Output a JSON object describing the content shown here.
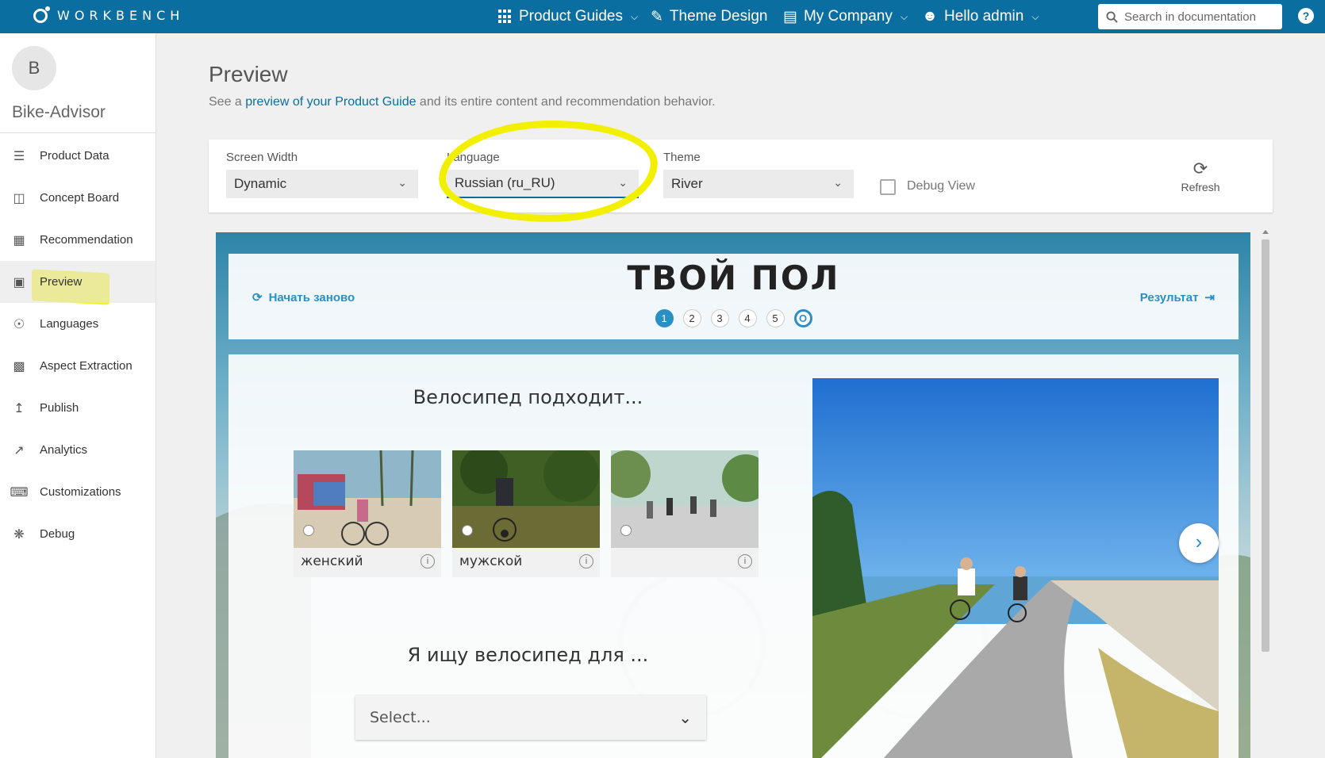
{
  "app": {
    "logo_text": "WORKBENCH"
  },
  "topnav": {
    "product_guides": "Product Guides",
    "theme_design": "Theme Design",
    "my_company": "My Company",
    "hello": "Hello admin",
    "search_placeholder": "Search in documentation",
    "help": "?"
  },
  "sidebar": {
    "avatar_letter": "B",
    "account_name": "Bike-Advisor",
    "items": [
      {
        "label": "Product Data",
        "icon": "database-icon"
      },
      {
        "label": "Concept Board",
        "icon": "book-icon"
      },
      {
        "label": "Recommendation",
        "icon": "gift-icon"
      },
      {
        "label": "Preview",
        "icon": "monitor-icon",
        "active": true
      },
      {
        "label": "Languages",
        "icon": "globe-icon"
      },
      {
        "label": "Aspect Extraction",
        "icon": "calculator-icon"
      },
      {
        "label": "Publish",
        "icon": "upload-icon"
      },
      {
        "label": "Analytics",
        "icon": "line-chart-icon"
      },
      {
        "label": "Customizations",
        "icon": "keyboard-icon"
      },
      {
        "label": "Debug",
        "icon": "bug-icon"
      }
    ]
  },
  "main": {
    "title": "Preview",
    "subtitle_pre": "See a ",
    "subtitle_link": "preview of your Product Guide",
    "subtitle_post": " and its entire content and recommendation behavior."
  },
  "settings": {
    "screen_width_label": "Screen Width",
    "screen_width_value": "Dynamic",
    "language_label": "Language",
    "language_value": "Russian (ru_RU)",
    "theme_label": "Theme",
    "theme_value": "River",
    "debug_label": "Debug View",
    "debug_checked": false,
    "refresh_label": "Refresh"
  },
  "guide": {
    "restart": "Начать заново",
    "title": "ТВОЙ ПОЛ",
    "result": "Результат",
    "steps": [
      "1",
      "2",
      "3",
      "4",
      "5",
      "О"
    ],
    "active_step": 1,
    "question1": "Велосипед подходит...",
    "options": [
      {
        "label": "женский"
      },
      {
        "label": "мужской"
      },
      {
        "label": ""
      }
    ],
    "question2": "Я ищу велосипед для ...",
    "select_placeholder": "Select..."
  },
  "colors": {
    "accent": "#0b6ea0",
    "guide_accent": "#2b8fc5",
    "highlight": "#f2f000"
  }
}
